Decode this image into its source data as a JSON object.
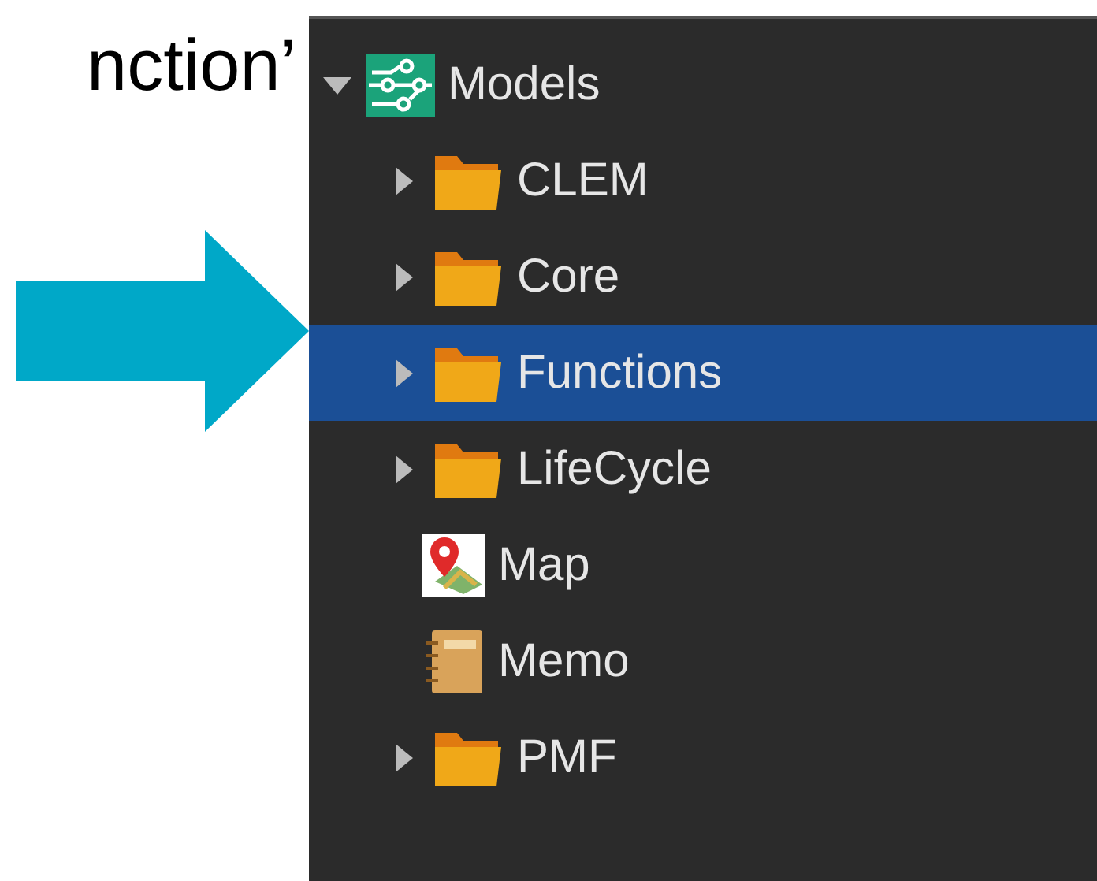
{
  "caption": "nction’",
  "tree": {
    "label": "Models",
    "kind": "models",
    "expanded": true,
    "selected": false,
    "children": [
      {
        "label": "CLEM",
        "kind": "folder",
        "expanded": false,
        "selected": false
      },
      {
        "label": "Core",
        "kind": "folder",
        "expanded": false,
        "selected": false
      },
      {
        "label": "Functions",
        "kind": "folder",
        "expanded": false,
        "selected": true
      },
      {
        "label": "LifeCycle",
        "kind": "folder",
        "expanded": false,
        "selected": false
      },
      {
        "label": "Map",
        "kind": "map",
        "selected": false
      },
      {
        "label": "Memo",
        "kind": "memo",
        "selected": false
      },
      {
        "label": "PMF",
        "kind": "folder",
        "expanded": false,
        "selected": false
      }
    ]
  }
}
